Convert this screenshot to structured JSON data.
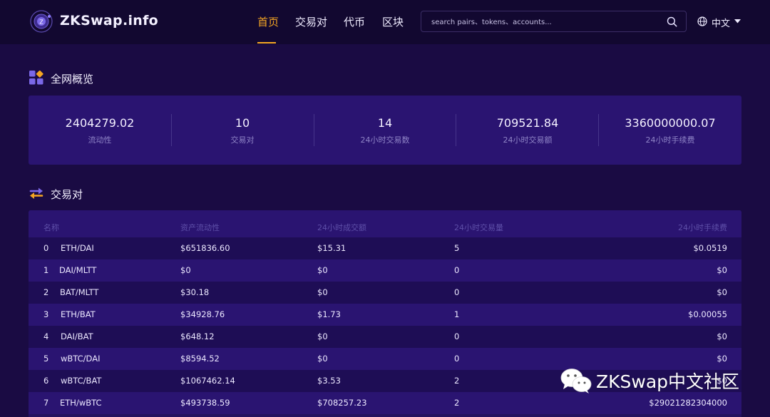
{
  "header": {
    "brand": "ZKSwap.info",
    "nav": [
      "首页",
      "交易对",
      "代币",
      "区块"
    ],
    "search_placeholder": "search pairs、tokens、accounts...",
    "language": "中文"
  },
  "overview": {
    "title": "全网概览",
    "stats": [
      {
        "value": "2404279.02",
        "label": "流动性"
      },
      {
        "value": "10",
        "label": "交易对"
      },
      {
        "value": "14",
        "label": "24小时交易数"
      },
      {
        "value": "709521.84",
        "label": "24小时交易额"
      },
      {
        "value": "3360000000.07",
        "label": "24小时手续费"
      }
    ]
  },
  "pairs": {
    "title": "交易对",
    "columns": [
      "名称",
      "资产流动性",
      "24小时成交额",
      "24小时交易量",
      "24小时手续费"
    ],
    "rows": [
      {
        "index": "0",
        "name": "ETH/DAI",
        "liquidity": "$651836.60",
        "volume": "$15.31",
        "txs": "5",
        "fee": "$0.0519"
      },
      {
        "index": "1",
        "name": "DAI/MLTT",
        "liquidity": "$0",
        "volume": "$0",
        "txs": "0",
        "fee": "$0"
      },
      {
        "index": "2",
        "name": "BAT/MLTT",
        "liquidity": "$30.18",
        "volume": "$0",
        "txs": "0",
        "fee": "$0"
      },
      {
        "index": "3",
        "name": "ETH/BAT",
        "liquidity": "$34928.76",
        "volume": "$1.73",
        "txs": "1",
        "fee": "$0.00055"
      },
      {
        "index": "4",
        "name": "DAI/BAT",
        "liquidity": "$648.12",
        "volume": "$0",
        "txs": "0",
        "fee": "$0"
      },
      {
        "index": "5",
        "name": "wBTC/DAI",
        "liquidity": "$8594.52",
        "volume": "$0",
        "txs": "0",
        "fee": "$0"
      },
      {
        "index": "6",
        "name": "wBTC/BAT",
        "liquidity": "$1067462.14",
        "volume": "$3.53",
        "txs": "2",
        "fee": "$0"
      },
      {
        "index": "7",
        "name": "ETH/wBTC",
        "liquidity": "$493738.59",
        "volume": "$708257.23",
        "txs": "2",
        "fee": "$29021282304000"
      }
    ]
  },
  "watermark": {
    "text": "ZKSwap中文社区",
    "icon": "wechat-icon"
  },
  "colors": {
    "background": "#1a0b43",
    "header": "#120830",
    "panel": "#2a1471",
    "accent": "#f5a623",
    "muted_text": "#8f84c6"
  }
}
